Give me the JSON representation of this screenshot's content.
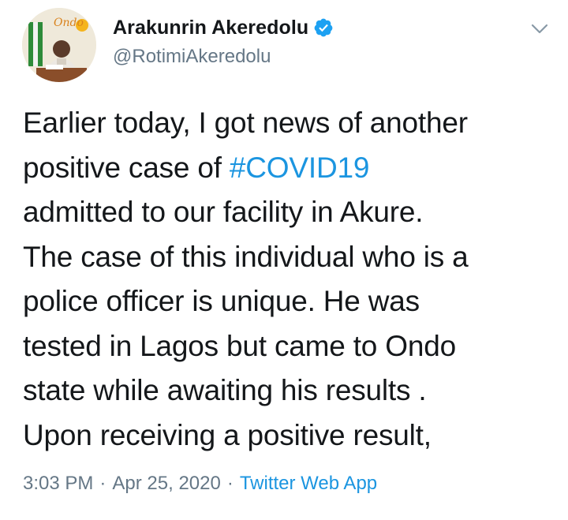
{
  "author": {
    "display_name": "Arakunrin Akeredolu",
    "handle": "@RotimiAkeredolu",
    "verified": true,
    "avatar_logo_text": "Ondo"
  },
  "tweet": {
    "lines": [
      {
        "before": "Earlier today, I got news of another",
        "hashtag": "",
        "after": ""
      },
      {
        "before": "positive case of ",
        "hashtag": "#COVID19",
        "after": ""
      },
      {
        "before": "admitted to our facility in Akure.",
        "hashtag": "",
        "after": ""
      },
      {
        "before": "The case of this individual who is a",
        "hashtag": "",
        "after": ""
      },
      {
        "before": "police officer is unique. He was",
        "hashtag": "",
        "after": ""
      },
      {
        "before": "tested in Lagos but came to Ondo",
        "hashtag": "",
        "after": ""
      },
      {
        "before": "state while awaiting his results .",
        "hashtag": "",
        "after": ""
      },
      {
        "before": "Upon receiving a positive result,",
        "hashtag": "",
        "after": ""
      }
    ]
  },
  "meta": {
    "time": "3:03 PM",
    "date": "Apr 25, 2020",
    "separator": "·",
    "source": "Twitter Web App"
  },
  "colors": {
    "text": "#14171a",
    "secondary": "#657786",
    "link": "#1b95e0",
    "verified": "#1da1f2"
  },
  "icons": {
    "verified": "verified-badge-icon",
    "menu": "chevron-down-icon"
  }
}
